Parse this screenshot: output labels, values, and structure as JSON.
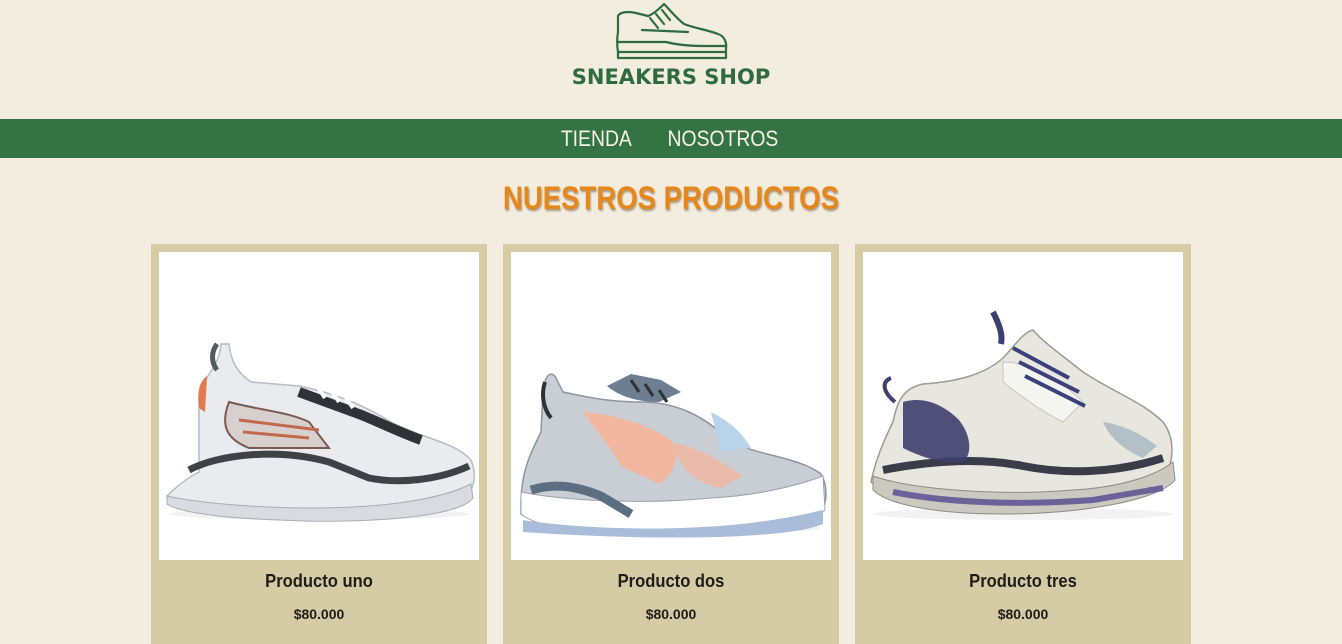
{
  "header": {
    "logo_icon": "sneaker-outline-icon",
    "brand": "SNEAKERS SHOP",
    "brand_color": "#2e6b3f"
  },
  "nav": {
    "background": "#347343",
    "items": [
      {
        "label": "TIENDA"
      },
      {
        "label": "NOSOTROS"
      }
    ]
  },
  "section": {
    "title": "NUESTROS PRODUCTOS",
    "title_color": "#e6871c"
  },
  "products": [
    {
      "name": "Producto uno",
      "price": "$80.000",
      "image": "white-grey-chunky-sneaker"
    },
    {
      "name": "Producto dos",
      "price": "$80.000",
      "image": "grey-peach-chunky-sneaker"
    },
    {
      "name": "Producto tres",
      "price": "$80.000",
      "image": "cream-navy-triple-sole-sneaker"
    }
  ]
}
